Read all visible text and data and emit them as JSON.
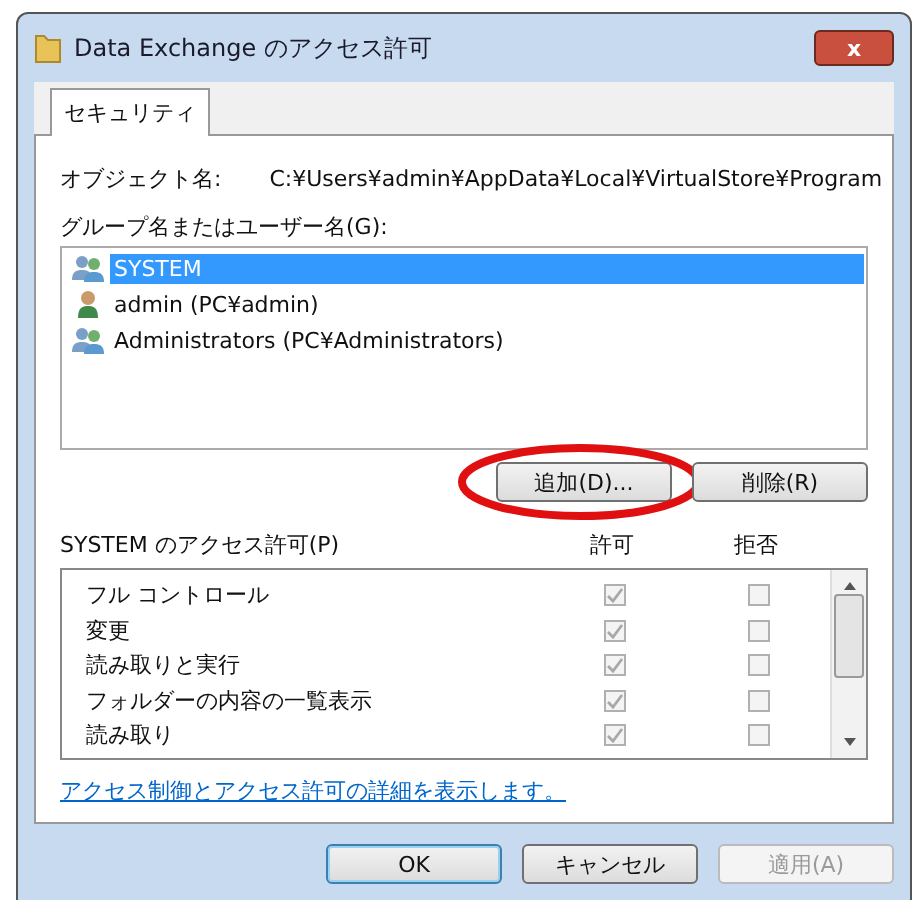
{
  "window": {
    "title": "Data Exchange のアクセス許可",
    "close": "x"
  },
  "tabs": [
    {
      "label": "セキュリティ",
      "selected": true
    }
  ],
  "object": {
    "label": "オブジェクト名:",
    "value": "C:¥Users¥admin¥AppData¥Local¥VirtualStore¥Program"
  },
  "users": {
    "label": "グループ名またはユーザー名(G):",
    "items": [
      {
        "name": "SYSTEM",
        "kind": "group",
        "selected": true
      },
      {
        "name": "admin (PC¥admin)",
        "kind": "user",
        "selected": false
      },
      {
        "name": "Administrators (PC¥Administrators)",
        "kind": "group",
        "selected": false
      }
    ],
    "buttons": [
      {
        "label": "追加(D)...",
        "highlighted": true
      },
      {
        "label": "削除(R)",
        "highlighted": false
      }
    ]
  },
  "permissions": {
    "label": "SYSTEM のアクセス許可(P)",
    "allow_header": "許可",
    "deny_header": "拒否",
    "rows": [
      {
        "name": "フル コントロール",
        "allow": true,
        "deny": false
      },
      {
        "name": "変更",
        "allow": true,
        "deny": false
      },
      {
        "name": "読み取りと実行",
        "allow": true,
        "deny": false
      },
      {
        "name": "フォルダーの内容の一覧表示",
        "allow": true,
        "deny": false
      },
      {
        "name": "読み取り",
        "allow": true,
        "deny": false
      }
    ]
  },
  "link": "アクセス制御とアクセス許可の詳細を表示します。",
  "buttons": [
    {
      "label": "OK",
      "disabled": false,
      "default": true
    },
    {
      "label": "キャンセル",
      "disabled": false,
      "default": false
    },
    {
      "label": "適用(A)",
      "disabled": true,
      "default": false
    }
  ]
}
